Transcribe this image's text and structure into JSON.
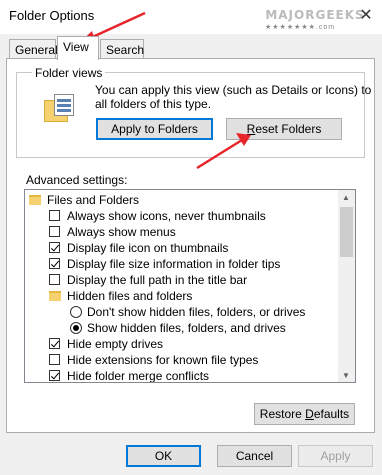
{
  "window": {
    "title": "Folder Options"
  },
  "watermark": {
    "text": "MAJORGEEKS",
    "stars": "★★★★★★★.com"
  },
  "tabs": [
    {
      "label": "General"
    },
    {
      "label": "View"
    },
    {
      "label": "Search"
    }
  ],
  "folder_views": {
    "title": "Folder views",
    "description_line1": "You can apply this view (such as Details or Icons) to",
    "description_line2": "all folders of this type.",
    "apply_label": "Apply to Folders",
    "reset_label_pre": "R",
    "reset_label_rest": "eset Folders"
  },
  "advanced": {
    "label": "Advanced settings:",
    "items": [
      {
        "label": "Files and Folders"
      },
      {
        "label": "Always show icons, never thumbnails"
      },
      {
        "label": "Always show menus"
      },
      {
        "label": "Display file icon on thumbnails"
      },
      {
        "label": "Display file size information in folder tips"
      },
      {
        "label": "Display the full path in the title bar"
      },
      {
        "label": "Hidden files and folders"
      },
      {
        "label": "Don't show hidden files, folders, or drives"
      },
      {
        "label": "Show hidden files, folders, and drives"
      },
      {
        "label": "Hide empty drives"
      },
      {
        "label": "Hide extensions for known file types"
      },
      {
        "label": "Hide folder merge conflicts"
      }
    ]
  },
  "restore_defaults": {
    "pre": "Restore ",
    "accel": "D",
    "post": "efaults"
  },
  "footer": {
    "ok": "OK",
    "cancel": "Cancel",
    "apply": "Apply"
  },
  "colors": {
    "arrow": "#e8242b",
    "focus": "#0078d7",
    "folder": "#f5d26f"
  }
}
